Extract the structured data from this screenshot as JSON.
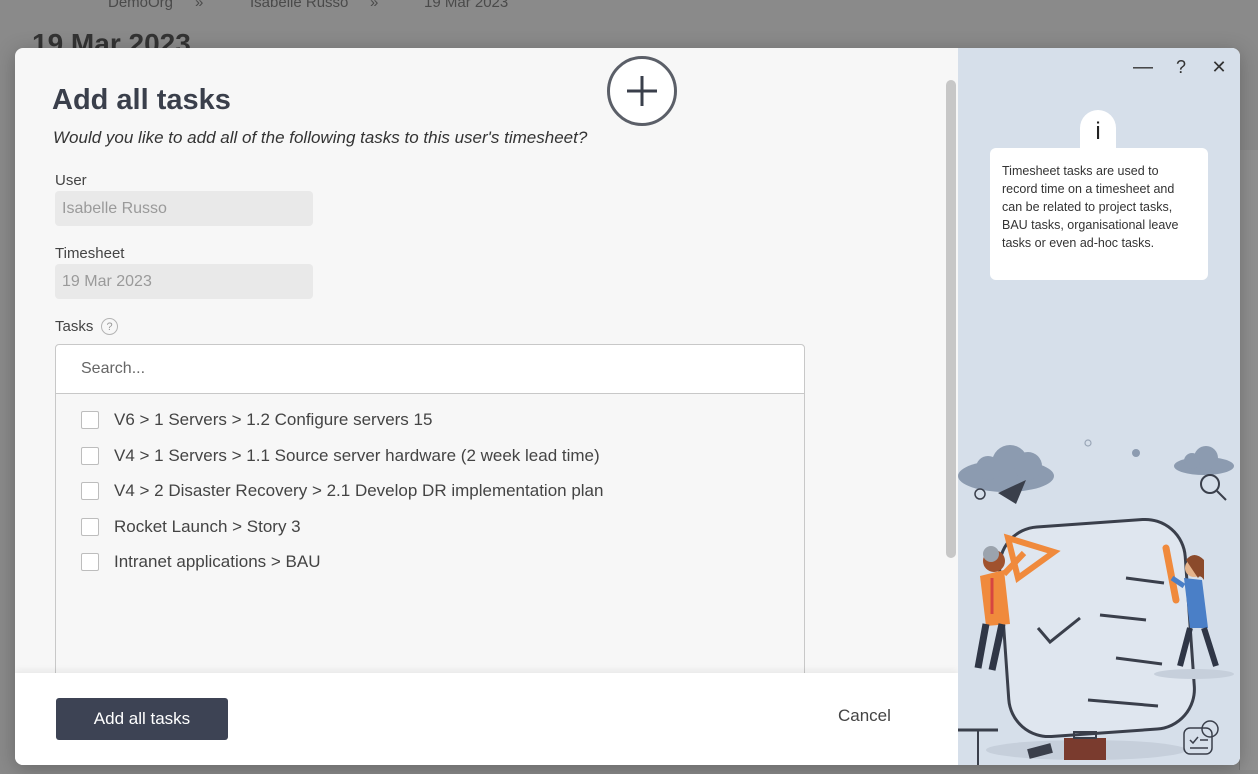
{
  "background": {
    "breadcrumb": [
      "DemoOrg",
      "»",
      "Isabelle Russo",
      "»",
      "19 Mar 2023"
    ],
    "page_title": "19 Mar 2023"
  },
  "dialog": {
    "title": "Add all tasks",
    "subtitle": "Would you like to add all of the following tasks to this user's timesheet?",
    "user_label": "User",
    "user_value": "Isabelle Russo",
    "timesheet_label": "Timesheet",
    "timesheet_value": "19 Mar 2023",
    "tasks_label": "Tasks",
    "help_glyph": "?",
    "search_placeholder": "Search...",
    "tasks": [
      {
        "label": "V6 > 1 Servers > 1.2 Configure servers 15",
        "checked": false
      },
      {
        "label": "V4 > 1 Servers > 1.1 Source server hardware (2 week lead time)",
        "checked": false
      },
      {
        "label": "V4 > 2 Disaster Recovery > 2.1 Develop DR implementation plan",
        "checked": false
      },
      {
        "label": "Rocket Launch > Story 3",
        "checked": false
      },
      {
        "label": "Intranet applications > BAU",
        "checked": false
      }
    ],
    "primary_button": "Add all tasks",
    "cancel_button": "Cancel"
  },
  "side_panel": {
    "minimize_glyph": "—",
    "help_glyph": "?",
    "close_glyph": "✕",
    "info_glyph": "i",
    "info_text": "Timesheet tasks are used to record time on a timesheet and can be related to project tasks, BAU tasks, organisational leave tasks or even ad-hoc tasks."
  },
  "colors": {
    "primary": "#3d4354",
    "side_panel_bg": "#d6dfea",
    "accent_orange": "#f08a3c",
    "accent_blue": "#4a7fc7"
  }
}
